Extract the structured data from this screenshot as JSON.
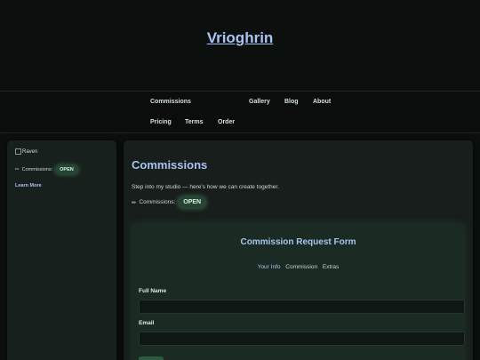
{
  "site": {
    "title": "Vrioghrin"
  },
  "nav": {
    "items": [
      "Commissions",
      "Gallery",
      "Blog",
      "About",
      "Pricing",
      "Terms",
      "Order"
    ]
  },
  "sidebar": {
    "avatar_alt": "Raven",
    "status_label": "Commissions:",
    "status_badge": "OPEN",
    "learn_more": "Learn More"
  },
  "main": {
    "heading": "Commissions",
    "intro": "Step into my studio — here's how we can create together.",
    "status_label": "Commissions:",
    "status_badge": "OPEN",
    "form": {
      "title": "Commission Request Form",
      "steps": [
        {
          "label": "Your Info",
          "active": true
        },
        {
          "label": "Commission",
          "active": false
        },
        {
          "label": "Extras",
          "active": false
        }
      ],
      "fields": [
        {
          "label": "Full Name",
          "value": ""
        },
        {
          "label": "Email",
          "value": ""
        }
      ]
    }
  },
  "colors": {
    "accent": "#a9c3f2",
    "background": "#0b0f0d",
    "panel": "#171e1b",
    "badge": "#254433"
  }
}
